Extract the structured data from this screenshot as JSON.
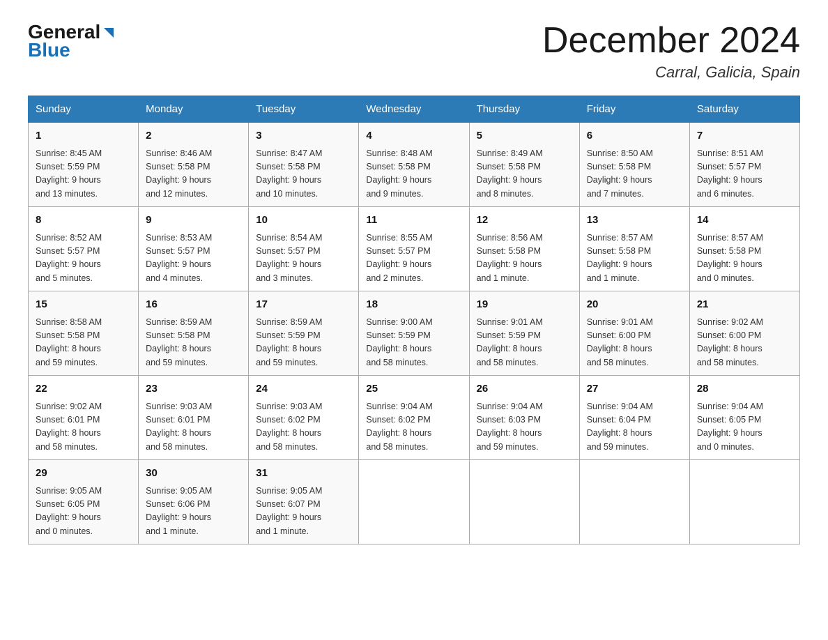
{
  "header": {
    "logo_general": "General",
    "logo_blue": "Blue",
    "month_title": "December 2024",
    "location": "Carral, Galicia, Spain"
  },
  "weekdays": [
    "Sunday",
    "Monday",
    "Tuesday",
    "Wednesday",
    "Thursday",
    "Friday",
    "Saturday"
  ],
  "weeks": [
    [
      {
        "day": "1",
        "sunrise": "8:45 AM",
        "sunset": "5:59 PM",
        "daylight": "9 hours and 13 minutes."
      },
      {
        "day": "2",
        "sunrise": "8:46 AM",
        "sunset": "5:58 PM",
        "daylight": "9 hours and 12 minutes."
      },
      {
        "day": "3",
        "sunrise": "8:47 AM",
        "sunset": "5:58 PM",
        "daylight": "9 hours and 10 minutes."
      },
      {
        "day": "4",
        "sunrise": "8:48 AM",
        "sunset": "5:58 PM",
        "daylight": "9 hours and 9 minutes."
      },
      {
        "day": "5",
        "sunrise": "8:49 AM",
        "sunset": "5:58 PM",
        "daylight": "9 hours and 8 minutes."
      },
      {
        "day": "6",
        "sunrise": "8:50 AM",
        "sunset": "5:58 PM",
        "daylight": "9 hours and 7 minutes."
      },
      {
        "day": "7",
        "sunrise": "8:51 AM",
        "sunset": "5:57 PM",
        "daylight": "9 hours and 6 minutes."
      }
    ],
    [
      {
        "day": "8",
        "sunrise": "8:52 AM",
        "sunset": "5:57 PM",
        "daylight": "9 hours and 5 minutes."
      },
      {
        "day": "9",
        "sunrise": "8:53 AM",
        "sunset": "5:57 PM",
        "daylight": "9 hours and 4 minutes."
      },
      {
        "day": "10",
        "sunrise": "8:54 AM",
        "sunset": "5:57 PM",
        "daylight": "9 hours and 3 minutes."
      },
      {
        "day": "11",
        "sunrise": "8:55 AM",
        "sunset": "5:57 PM",
        "daylight": "9 hours and 2 minutes."
      },
      {
        "day": "12",
        "sunrise": "8:56 AM",
        "sunset": "5:58 PM",
        "daylight": "9 hours and 1 minute."
      },
      {
        "day": "13",
        "sunrise": "8:57 AM",
        "sunset": "5:58 PM",
        "daylight": "9 hours and 1 minute."
      },
      {
        "day": "14",
        "sunrise": "8:57 AM",
        "sunset": "5:58 PM",
        "daylight": "9 hours and 0 minutes."
      }
    ],
    [
      {
        "day": "15",
        "sunrise": "8:58 AM",
        "sunset": "5:58 PM",
        "daylight": "8 hours and 59 minutes."
      },
      {
        "day": "16",
        "sunrise": "8:59 AM",
        "sunset": "5:58 PM",
        "daylight": "8 hours and 59 minutes."
      },
      {
        "day": "17",
        "sunrise": "8:59 AM",
        "sunset": "5:59 PM",
        "daylight": "8 hours and 59 minutes."
      },
      {
        "day": "18",
        "sunrise": "9:00 AM",
        "sunset": "5:59 PM",
        "daylight": "8 hours and 58 minutes."
      },
      {
        "day": "19",
        "sunrise": "9:01 AM",
        "sunset": "5:59 PM",
        "daylight": "8 hours and 58 minutes."
      },
      {
        "day": "20",
        "sunrise": "9:01 AM",
        "sunset": "6:00 PM",
        "daylight": "8 hours and 58 minutes."
      },
      {
        "day": "21",
        "sunrise": "9:02 AM",
        "sunset": "6:00 PM",
        "daylight": "8 hours and 58 minutes."
      }
    ],
    [
      {
        "day": "22",
        "sunrise": "9:02 AM",
        "sunset": "6:01 PM",
        "daylight": "8 hours and 58 minutes."
      },
      {
        "day": "23",
        "sunrise": "9:03 AM",
        "sunset": "6:01 PM",
        "daylight": "8 hours and 58 minutes."
      },
      {
        "day": "24",
        "sunrise": "9:03 AM",
        "sunset": "6:02 PM",
        "daylight": "8 hours and 58 minutes."
      },
      {
        "day": "25",
        "sunrise": "9:04 AM",
        "sunset": "6:02 PM",
        "daylight": "8 hours and 58 minutes."
      },
      {
        "day": "26",
        "sunrise": "9:04 AM",
        "sunset": "6:03 PM",
        "daylight": "8 hours and 59 minutes."
      },
      {
        "day": "27",
        "sunrise": "9:04 AM",
        "sunset": "6:04 PM",
        "daylight": "8 hours and 59 minutes."
      },
      {
        "day": "28",
        "sunrise": "9:04 AM",
        "sunset": "6:05 PM",
        "daylight": "9 hours and 0 minutes."
      }
    ],
    [
      {
        "day": "29",
        "sunrise": "9:05 AM",
        "sunset": "6:05 PM",
        "daylight": "9 hours and 0 minutes."
      },
      {
        "day": "30",
        "sunrise": "9:05 AM",
        "sunset": "6:06 PM",
        "daylight": "9 hours and 1 minute."
      },
      {
        "day": "31",
        "sunrise": "9:05 AM",
        "sunset": "6:07 PM",
        "daylight": "9 hours and 1 minute."
      },
      null,
      null,
      null,
      null
    ]
  ],
  "labels": {
    "sunrise": "Sunrise:",
    "sunset": "Sunset:",
    "daylight": "Daylight:"
  }
}
